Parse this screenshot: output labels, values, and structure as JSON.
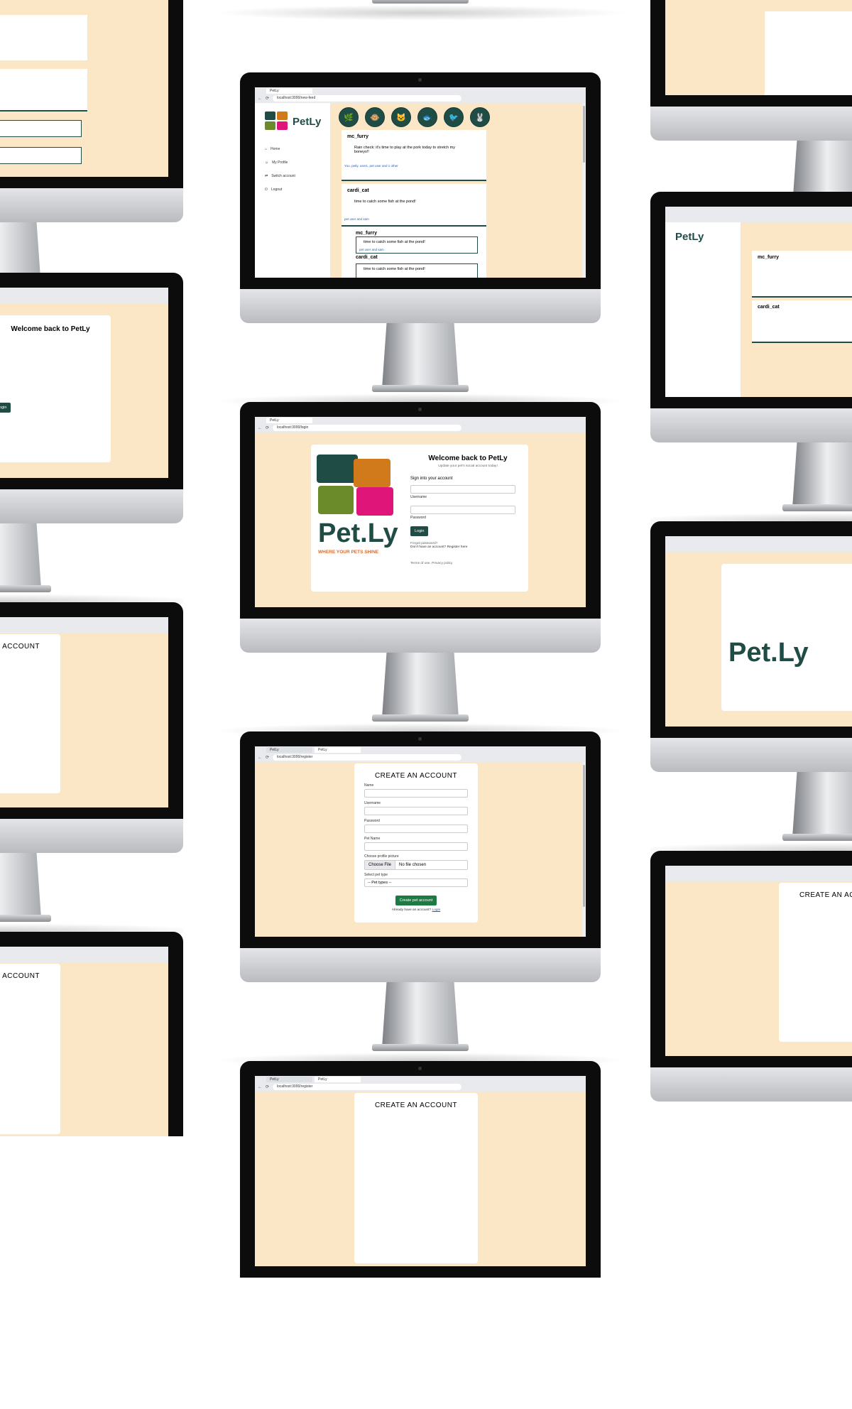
{
  "browser": {
    "tab_title": "PetLy",
    "url_feed": "localhost:3000/new-feed",
    "url_login": "localhost:3000/login",
    "url_register": "localhost:3000/register"
  },
  "feed": {
    "brand": "PetLy",
    "nav": [
      {
        "icon": "home-icon",
        "label": "Home"
      },
      {
        "icon": "user-icon",
        "label": "My Profile"
      },
      {
        "icon": "switch-icon",
        "label": "Switch account"
      },
      {
        "icon": "logout-icon",
        "label": "Logout"
      }
    ],
    "posts": [
      {
        "user": "mc_furry",
        "text": "Rain check: it's time to play at the pork today to stretch my boneys!!",
        "likes": "You, petly. user1, pet user and 1 other"
      },
      {
        "user": "cardi_cat",
        "text": "time to catch some fish at the pond!",
        "likes": "pet user and sam"
      }
    ],
    "shares": [
      {
        "user": "mc_furry",
        "text": "time to catch some fish at the pond!",
        "likes": "pet user and sam"
      },
      {
        "user": "cardi_cat",
        "text": "time to catch some fish at the pond!"
      }
    ]
  },
  "login": {
    "title": "Welcome back to PetLy",
    "subtitle": "Update your pet's social account today!",
    "heading": "Sign into your account",
    "username_label": "Username",
    "password_label": "Password",
    "login_button": "Login",
    "forgot": "Forgot password?",
    "register": "Don't have an account? Register here",
    "terms": "Terms of use. Privacy policy",
    "logo_word": "Pet.Ly",
    "logo_tagline": "WHERE YOUR PETS SHINE"
  },
  "register": {
    "title": "CREATE AN ACCOUNT",
    "name_label": "Name",
    "username_label": "Username",
    "password_label": "Password",
    "petname_label": "Pet Name",
    "picture_label": "Choose profile picture",
    "file_button": "Choose File",
    "file_status": "No file chosen",
    "pettype_label": "Select pet type",
    "pettype_value": "-- Pet types --",
    "create_button": "Create pet account",
    "already": "Already have an account?",
    "login_link": "Login"
  }
}
